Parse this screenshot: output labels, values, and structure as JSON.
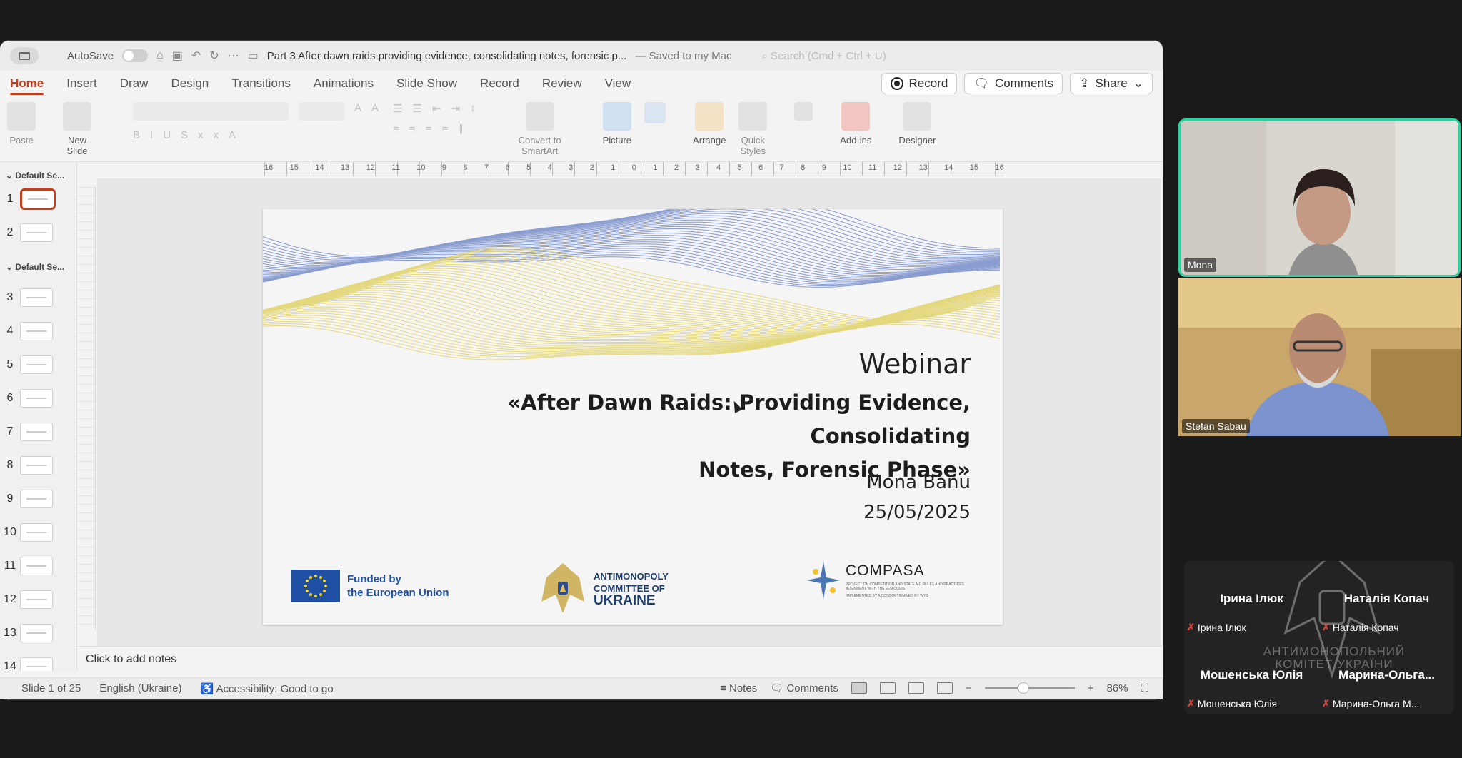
{
  "titlebar": {
    "autosave_label": "AutoSave",
    "document_title": "Part 3 After dawn raids providing evidence, consolidating notes, forensic p...",
    "saved_status": "— Saved to my Mac",
    "search_placeholder": "Search (Cmd + Ctrl + U)"
  },
  "ribbon_tabs": [
    "Home",
    "Insert",
    "Draw",
    "Design",
    "Transitions",
    "Animations",
    "Slide Show",
    "Record",
    "Review",
    "View"
  ],
  "tab_actions": {
    "record": "Record",
    "comments": "Comments",
    "share": "Share"
  },
  "ribbon": {
    "paste": "Paste",
    "new_slide_1": "New",
    "new_slide_2": "Slide",
    "convert_1": "Convert to",
    "convert_2": "SmartArt",
    "picture": "Picture",
    "arrange": "Arrange",
    "quick_styles_1": "Quick",
    "quick_styles_2": "Styles",
    "addins": "Add-ins",
    "designer": "Designer"
  },
  "sections": [
    "Default Se...",
    "Default Se..."
  ],
  "slide_numbers": [
    "1",
    "2",
    "3",
    "4",
    "5",
    "6",
    "7",
    "8",
    "9",
    "10",
    "11",
    "12",
    "13",
    "14"
  ],
  "ruler_numbers": [
    "16",
    "15",
    "14",
    "13",
    "12",
    "11",
    "10",
    "9",
    "8",
    "7",
    "6",
    "5",
    "4",
    "3",
    "2",
    "1",
    "0",
    "1",
    "2",
    "3",
    "4",
    "5",
    "6",
    "7",
    "8",
    "9",
    "10",
    "11",
    "12",
    "13",
    "14",
    "15",
    "16"
  ],
  "slide": {
    "heading": "Webinar",
    "title_line1": "«After Dawn Raids: Providing Evidence, Consolidating",
    "title_line2": "Notes, Forensic Phase»",
    "author": "Mona Banu",
    "date": "25/05/2025",
    "eu_line1": "Funded by",
    "eu_line2": "the European Union",
    "amcu_line1": "ANTIMONOPOLY",
    "amcu_line2": "COMMITTEE OF",
    "amcu_line3": "UKRAINE",
    "compasa_name": "COMPASA",
    "compasa_sub": "PROJECT ON COMPETITION AND STATE AID RULES AND PRACTICES ALIGNMENT WITH THE EU ACQUIS",
    "compasa_impl": "IMPLEMENTED BY A CONSORTIUM LED BY WYG"
  },
  "notes_placeholder": "Click to add notes",
  "statusbar": {
    "slide_info": "Slide 1 of 25",
    "language": "English (Ukraine)",
    "accessibility": "Accessibility: Good to go",
    "notes": "Notes",
    "comments": "Comments",
    "zoom": "86%",
    "zoom_fraction": 0.42
  },
  "videos": [
    {
      "name": "Mona"
    },
    {
      "name": "Stefan Sabau"
    }
  ],
  "gallery": {
    "watermark_line1": "АНТИМОНОПОЛЬНИЙ",
    "watermark_line2": "КОМІТЕТ УКРАЇНИ",
    "participants": [
      {
        "name": "Ірина Ілюк",
        "tag": "Ірина Ілюк"
      },
      {
        "name": "Наталія Копач",
        "tag": "Наталія Копач"
      },
      {
        "name": "Мошенська Юлія",
        "tag": "Мошенська Юлія"
      },
      {
        "name": "Марина-Ольга...",
        "tag": "Марина-Ольга М..."
      }
    ]
  },
  "colors": {
    "accent": "#c43e1c",
    "active_speaker": "#29d4a0",
    "eu_blue": "#1f4fa3",
    "ua_blue": "#6f86c7",
    "ua_yellow": "#e8dc7a"
  }
}
